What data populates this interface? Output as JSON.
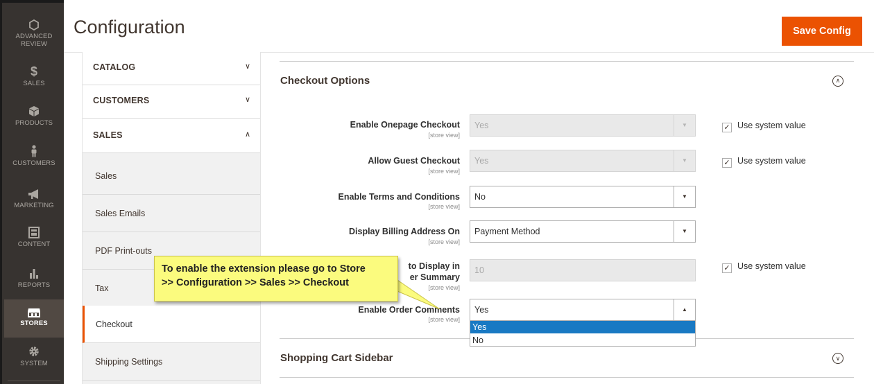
{
  "nav": [
    {
      "label": "ADVANCED REVIEW",
      "icon": "hexagon-icon"
    },
    {
      "label": "SALES",
      "icon": "dollar-icon"
    },
    {
      "label": "PRODUCTS",
      "icon": "cube-icon"
    },
    {
      "label": "CUSTOMERS",
      "icon": "person-icon"
    },
    {
      "label": "MARKETING",
      "icon": "megaphone-icon"
    },
    {
      "label": "CONTENT",
      "icon": "layout-icon"
    },
    {
      "label": "REPORTS",
      "icon": "bar-chart-icon"
    },
    {
      "label": "STORES",
      "icon": "store-icon"
    },
    {
      "label": "SYSTEM",
      "icon": "gear-icon"
    }
  ],
  "header": {
    "title": "Configuration",
    "save_label": "Save Config"
  },
  "tabs": {
    "catalog": "CATALOG",
    "customers": "CUSTOMERS",
    "sales": "SALES",
    "sales_items": [
      "Sales",
      "Sales Emails",
      "PDF Print-outs",
      "Tax",
      "Checkout",
      "Shipping Settings"
    ]
  },
  "section": {
    "title": "Checkout Options",
    "scope": "[store view]",
    "use_system_value": "Use system value",
    "rows": [
      {
        "label": "Enable Onepage Checkout",
        "value": "Yes"
      },
      {
        "label": "Allow Guest Checkout",
        "value": "Yes"
      },
      {
        "label": "Enable Terms and Conditions",
        "value": "No"
      },
      {
        "label": "Display Billing Address On",
        "value": "Payment Method"
      },
      {
        "label_line1": "to Display in",
        "label_line2": "er Summary",
        "value": "10"
      },
      {
        "label": "Enable Order Comments",
        "value": "Yes"
      }
    ],
    "dropdown_options": [
      "Yes",
      "No"
    ]
  },
  "section2": {
    "title": "Shopping Cart Sidebar"
  },
  "callout": {
    "line1": "To enable the extension please go to Store",
    "line2": ">> Configuration >> Sales >> Checkout"
  },
  "colors": {
    "accent": "#eb5202",
    "nav_bg": "#373330",
    "highlight": "#1979c3",
    "callout": "#fbfb7e"
  }
}
